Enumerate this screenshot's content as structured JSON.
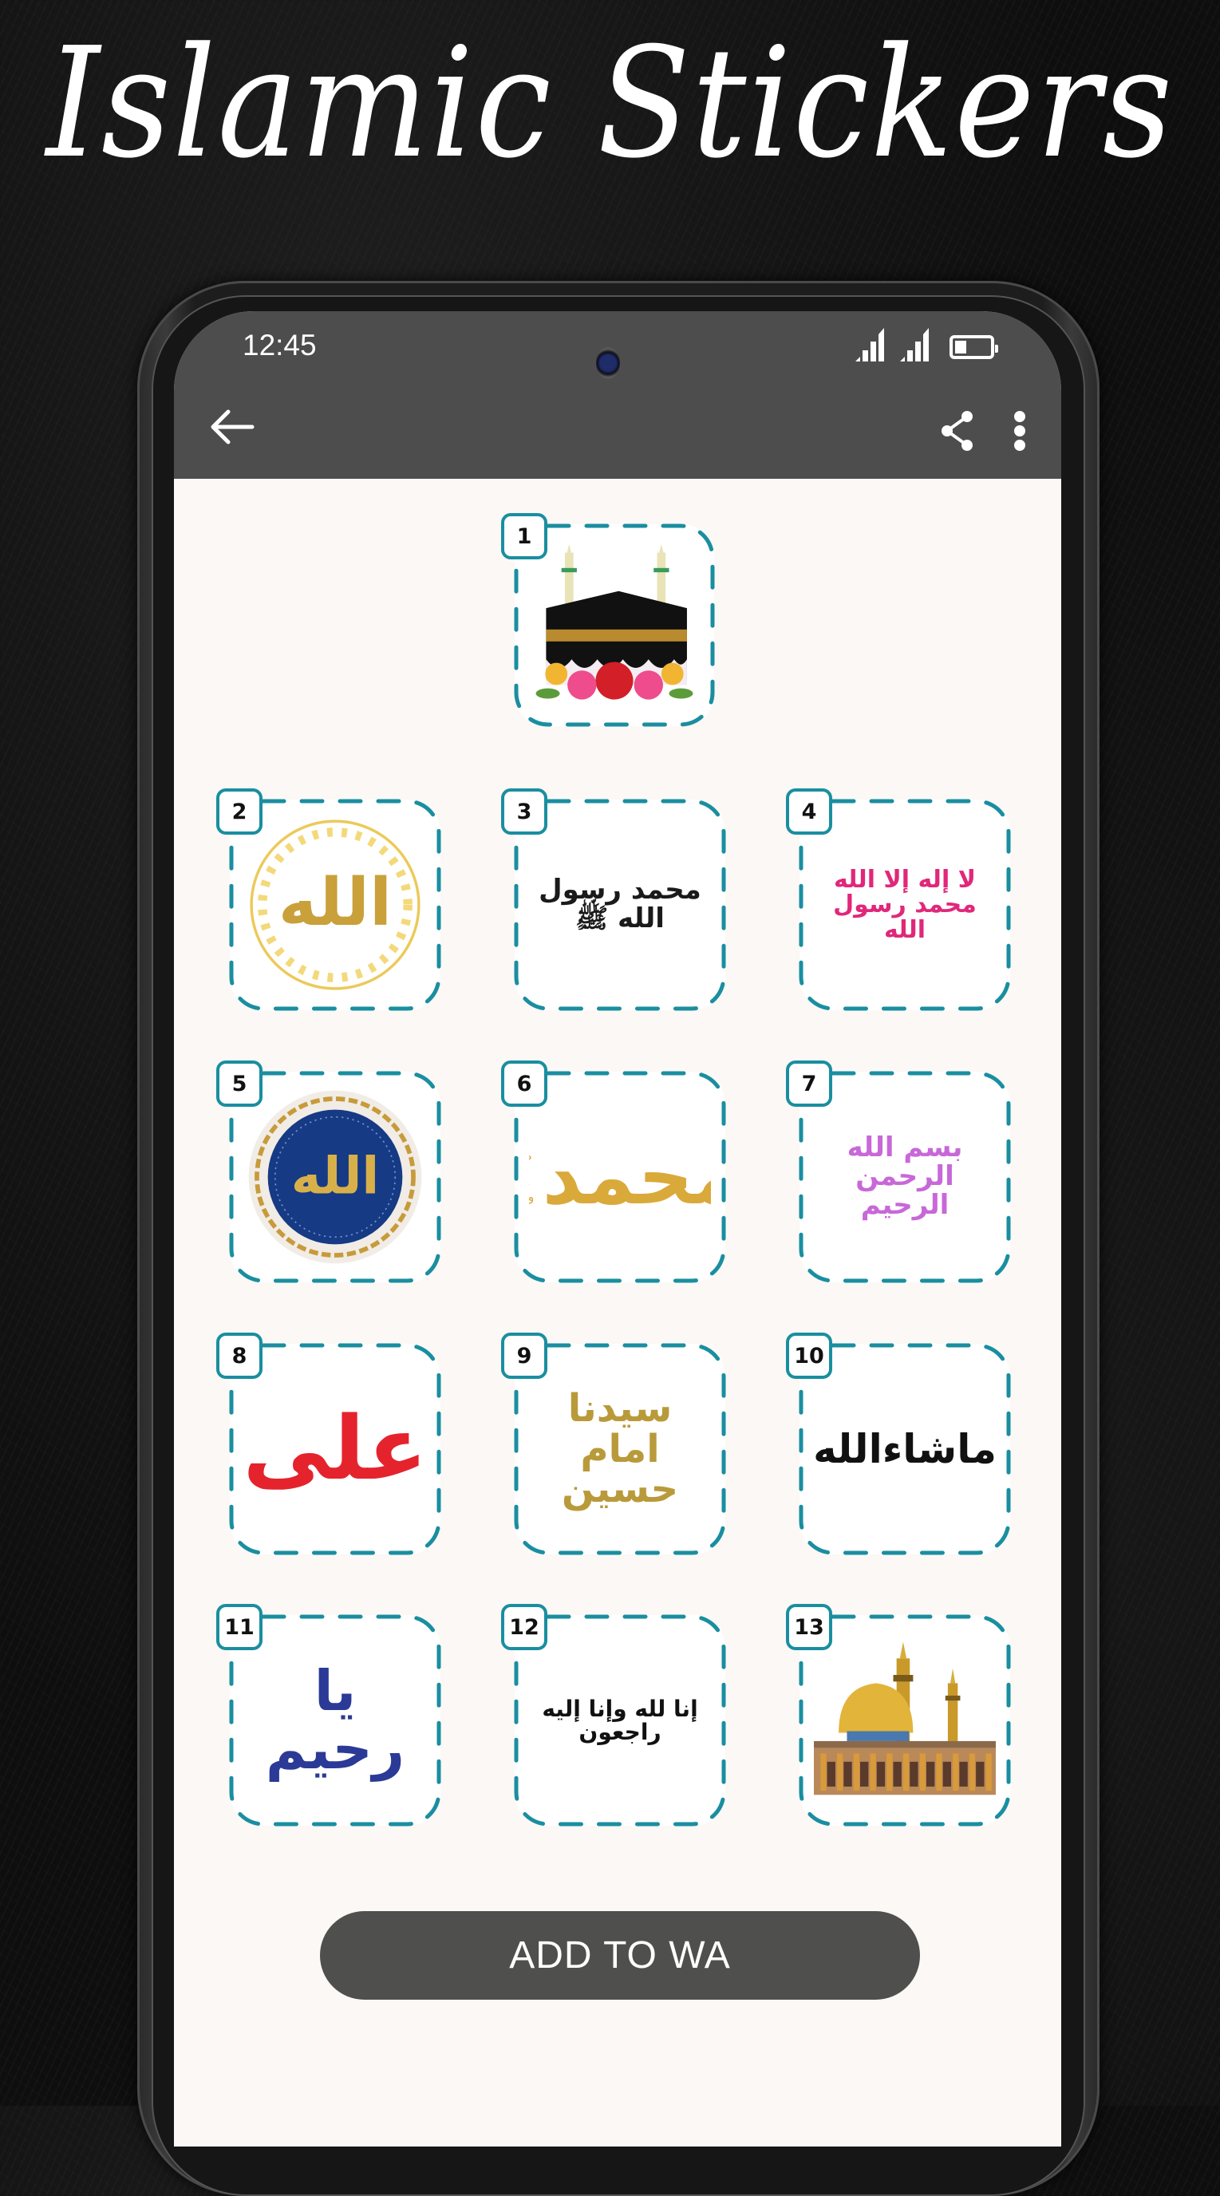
{
  "promo": {
    "title": "Islamic Stickers"
  },
  "status_bar": {
    "time": "12:45",
    "battery_level": 0.33,
    "signal_icons": [
      "signal-sim1-icon",
      "signal-sim2-icon"
    ]
  },
  "toolbar": {
    "back_icon": "arrow-left-icon",
    "share_icon": "share-icon",
    "more_icon": "more-vertical-icon"
  },
  "accent_color": "#1a8ea0",
  "stickers": [
    {
      "number": "1",
      "subject": "Kaaba with flowers",
      "type": "image"
    },
    {
      "number": "2",
      "subject": "Allah gold circle",
      "text": "الله",
      "color": "#c9a03a"
    },
    {
      "number": "3",
      "subject": "Muhammad Rasul Allah",
      "text": "محمد رسول الله ﷺ",
      "color": "#1a1a1a"
    },
    {
      "number": "4",
      "subject": "Kalima",
      "text": "لا إله إلا الله محمد رسول الله",
      "color": "#e0287a"
    },
    {
      "number": "5",
      "subject": "Allah blue medallion",
      "text": "الله",
      "color": "#d8b04a"
    },
    {
      "number": "6",
      "subject": "Muhammad gold",
      "text": "محمد",
      "subtext": "صلى الله عليه وسلم",
      "color": "#d9a93a"
    },
    {
      "number": "7",
      "subject": "Bismillah",
      "text": "بسم الله الرحمن الرحيم",
      "color": "#c868d8"
    },
    {
      "number": "8",
      "subject": "Ali",
      "text": "علی",
      "color": "#e5232d"
    },
    {
      "number": "9",
      "subject": "Syedna Imam Hussain",
      "text": "سیدنا امام حسین",
      "color": "#b99a3a"
    },
    {
      "number": "10",
      "subject": "Mashallah",
      "text": "ماشاءالله",
      "color": "#111111"
    },
    {
      "number": "11",
      "subject": "Ya Raheem",
      "text": "یا رحیم",
      "color": "#2b3a96"
    },
    {
      "number": "12",
      "subject": "Inna lillahi",
      "text": "إنا لله وإنا إليه راجعون",
      "color": "#111111"
    },
    {
      "number": "13",
      "subject": "Shrine with golden dome",
      "type": "image"
    }
  ],
  "actions": {
    "add_label": "ADD TO WA"
  }
}
